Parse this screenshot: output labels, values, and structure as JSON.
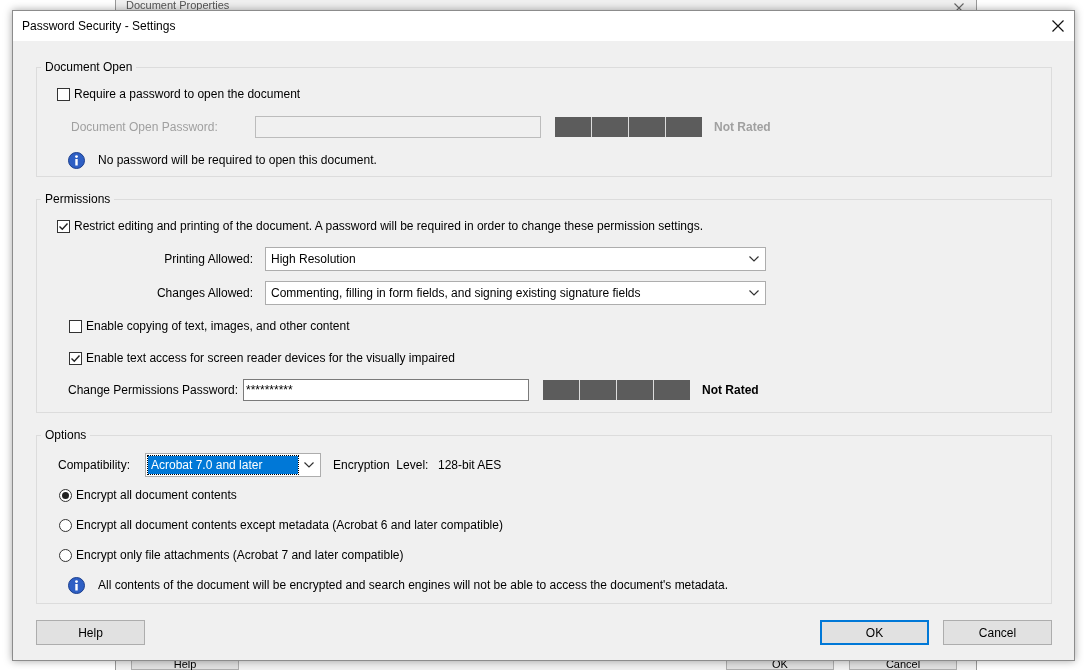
{
  "background_window": {
    "title": "Document Properties",
    "buttons": [
      "Help",
      "OK",
      "Cancel"
    ]
  },
  "window": {
    "title": "Password Security - Settings"
  },
  "document_open": {
    "title": "Document Open",
    "require_password": {
      "label": "Require a password to open the document",
      "checked": false
    },
    "password_field": {
      "label": "Document Open Password:",
      "disabled": true
    },
    "strength": {
      "label": "Not Rated",
      "disabled": true
    },
    "info": "No password will be required to open this document."
  },
  "permissions": {
    "title": "Permissions",
    "restrict": {
      "label": "Restrict editing and printing of the document. A password will be required in order to change these permission settings.",
      "checked": true
    },
    "dropdowns": [
      {
        "label": "Printing Allowed:",
        "value": "High Resolution"
      },
      {
        "label": "Changes Allowed:",
        "value": "Commenting, filling in form fields, and signing existing signature fields"
      }
    ],
    "checkboxes": [
      {
        "label": "Enable copying of text, images, and other content",
        "checked": false
      },
      {
        "label": "Enable text access for screen reader devices for the visually impaired",
        "checked": true
      }
    ],
    "password_field": {
      "label": "Change Permissions Password:",
      "value": "**********",
      "disabled": false
    },
    "strength": {
      "label": "Not Rated",
      "disabled": false
    }
  },
  "options": {
    "title": "Options",
    "compatibility": {
      "label": "Compatibility:",
      "value": "Acrobat 7.0 and later",
      "highlighted": true
    },
    "encryption_label": "Encryption  Level:",
    "encryption_value": "128-bit AES",
    "radios": [
      {
        "label": "Encrypt all document contents",
        "selected": true
      },
      {
        "label": "Encrypt all document contents except metadata (Acrobat 6 and later compatible)",
        "selected": false
      },
      {
        "label": "Encrypt only file attachments (Acrobat 7 and later compatible)",
        "selected": false
      }
    ],
    "info": "All contents of the document will be encrypted and search engines will not be able to access the document's metadata."
  },
  "buttons": [
    {
      "label": "Help",
      "default": false
    },
    {
      "label": "OK",
      "default": true
    },
    {
      "label": "Cancel",
      "default": false
    }
  ]
}
